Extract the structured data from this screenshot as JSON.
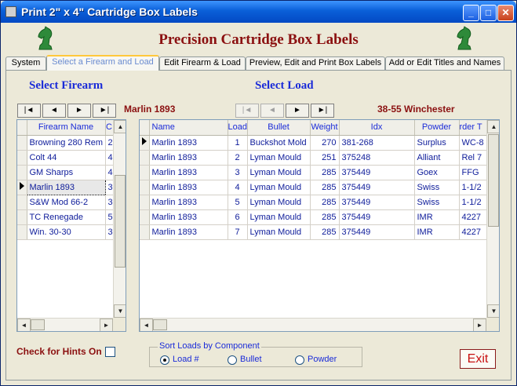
{
  "window": {
    "title": "Print 2\"  x  4\" Cartridge Box Labels",
    "minimize": "_",
    "maximize": "□",
    "close": "✕"
  },
  "header": {
    "title": "Precision Cartridge Box Labels"
  },
  "tabs": [
    {
      "label": "System"
    },
    {
      "label": "Select a Firearm and Load"
    },
    {
      "label": "Edit Firearm & Load"
    },
    {
      "label": "Preview, Edit and Print Box Labels"
    },
    {
      "label": "Add or Edit Titles and Names"
    }
  ],
  "firearm": {
    "title": "Select Firearm",
    "current": "Marlin 1893",
    "nav": {
      "first": "|◄",
      "prev": "◄",
      "next": "►",
      "last": "►|"
    },
    "columns": [
      "Firearm Name",
      "C"
    ],
    "rows": [
      {
        "name": "Browning 280 Rem",
        "c": "2"
      },
      {
        "name": "Colt 44",
        "c": "4"
      },
      {
        "name": "GM Sharps",
        "c": "4"
      },
      {
        "name": "Marlin 1893",
        "c": "3"
      },
      {
        "name": "S&W Mod 66-2",
        "c": "3"
      },
      {
        "name": "TC Renegade",
        "c": "5"
      },
      {
        "name": "Win. 30-30",
        "c": "3"
      }
    ]
  },
  "load": {
    "title": "Select Load",
    "current": "38-55 Winchester",
    "nav": {
      "first": "|◄",
      "prev": "◄",
      "next": "►",
      "last": "►|"
    },
    "columns": [
      "Name",
      "Load",
      "Bullet",
      "Weight",
      "Idx",
      "Powder",
      "rder T"
    ],
    "rows": [
      {
        "name": "Marlin 1893",
        "load": "1",
        "bullet": "Buckshot Mold",
        "weight": "270",
        "idx": "381-268",
        "powder": "Surplus",
        "order": "WC-8"
      },
      {
        "name": "Marlin 1893",
        "load": "2",
        "bullet": "Lyman Mould",
        "weight": "251",
        "idx": "375248",
        "powder": "Alliant",
        "order": "Rel 7"
      },
      {
        "name": "Marlin 1893",
        "load": "3",
        "bullet": "Lyman Mould",
        "weight": "285",
        "idx": "375449",
        "powder": "Goex",
        "order": "FFG"
      },
      {
        "name": "Marlin 1893",
        "load": "4",
        "bullet": "Lyman Mould",
        "weight": "285",
        "idx": "375449",
        "powder": "Swiss",
        "order": "1-1/2"
      },
      {
        "name": "Marlin 1893",
        "load": "5",
        "bullet": "Lyman Mould",
        "weight": "285",
        "idx": "375449",
        "powder": "Swiss",
        "order": "1-1/2"
      },
      {
        "name": "Marlin 1893",
        "load": "6",
        "bullet": "Lyman Mould",
        "weight": "285",
        "idx": "375449",
        "powder": "IMR",
        "order": "4227"
      },
      {
        "name": "Marlin 1893",
        "load": "7",
        "bullet": "Lyman Mould",
        "weight": "285",
        "idx": "375449",
        "powder": "IMR",
        "order": "4227"
      }
    ]
  },
  "hints": {
    "label": "Check for Hints On"
  },
  "sort": {
    "label": "Sort Loads by Component",
    "options": [
      "Load #",
      "Bullet",
      "Powder"
    ],
    "selected": "Load #"
  },
  "exit": {
    "label": "Exit"
  },
  "colors": {
    "accent": "#8b1010",
    "label_blue": "#1a2bd8",
    "title_bar": "#0a5fd8"
  }
}
